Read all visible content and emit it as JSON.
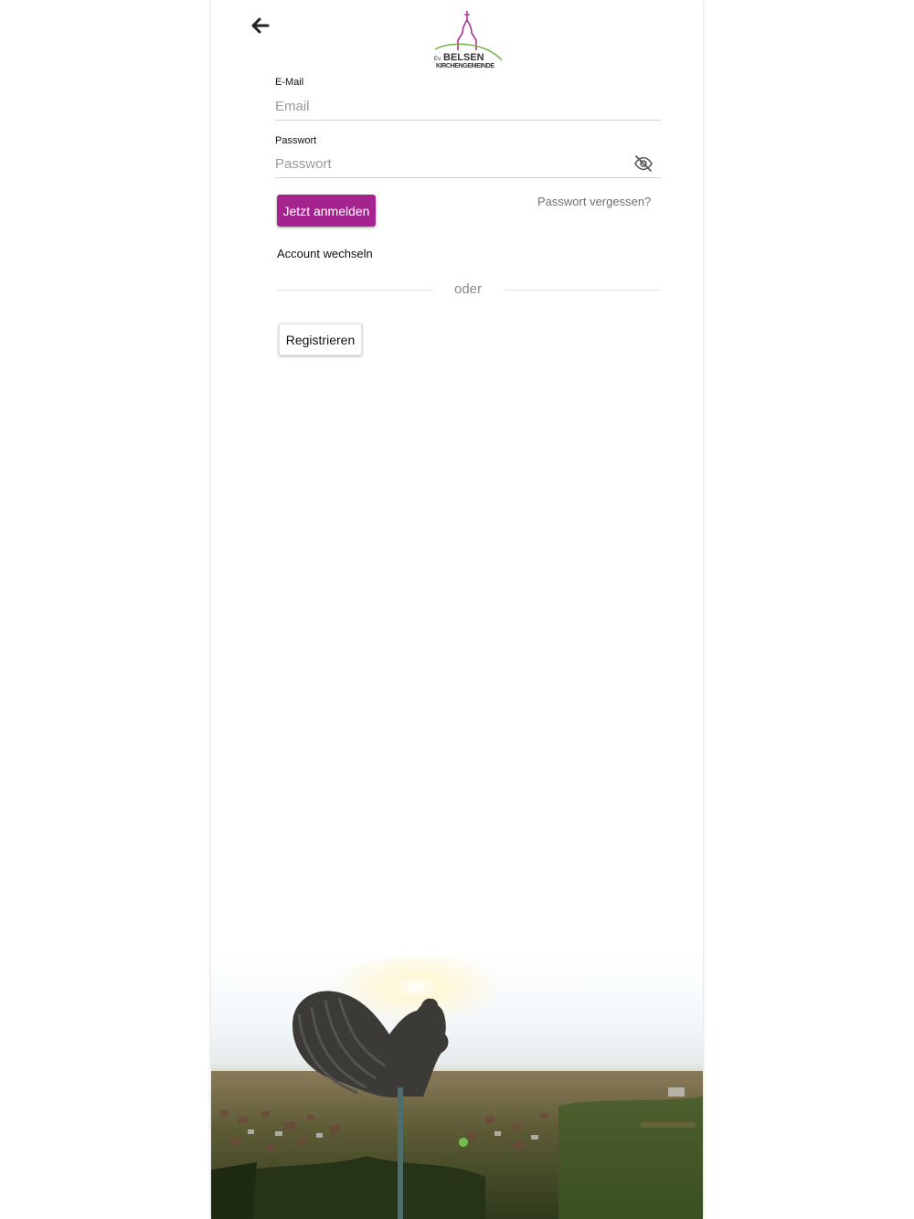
{
  "logo": {
    "prefix": "Ev.",
    "name": "BELSEN",
    "subtitle": "KIRCHENGEMEINDE",
    "accent": "#a5238e",
    "green": "#7ab648"
  },
  "header": {
    "back_icon": "arrow-left-icon"
  },
  "form": {
    "email": {
      "label": "E-Mail",
      "placeholder": "Email",
      "value": ""
    },
    "password": {
      "label": "Passwort",
      "placeholder": "Passwort",
      "value": "",
      "toggle_icon": "eye-off-icon"
    }
  },
  "actions": {
    "login_label": "Jetzt anmelden",
    "forgot_label": "Passwort vergessen?",
    "switch_account_label": "Account wechseln",
    "divider_label": "oder",
    "register_label": "Registrieren"
  },
  "colors": {
    "primary": "#a5238e",
    "text": "#111111",
    "muted": "#8a8a8a"
  },
  "background_image": {
    "subject": "rooster-weathervane-sunset-over-village"
  }
}
